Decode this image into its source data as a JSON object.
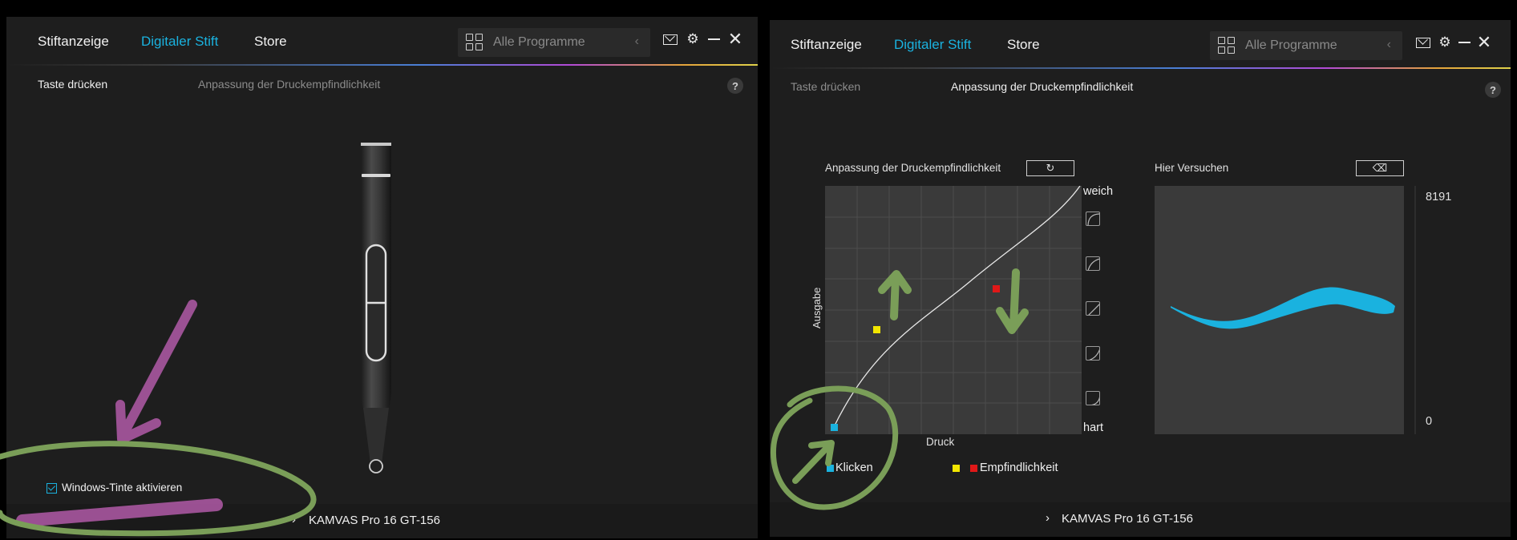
{
  "tabs": [
    {
      "label": "Stiftanzeige"
    },
    {
      "label": "Digitaler Stift"
    },
    {
      "label": "Store"
    }
  ],
  "search": {
    "placeholder": "Alle Programme"
  },
  "subtabs": {
    "press_key": "Taste drücken",
    "pressure": "Anpassung der Druckempfindlichkeit"
  },
  "help_label": "?",
  "left_panel": {
    "windows_ink": {
      "label": "Windows-Tinte aktivieren",
      "checked": true
    }
  },
  "right_panel": {
    "curve_title": "Anpassung der Druckempfindlichkeit",
    "try_title": "Hier Versuchen",
    "axis_x": "Druck",
    "axis_y": "Ausgabe",
    "soft_label": "weich",
    "hard_label": "hart",
    "pressure_max": "8191",
    "pressure_min": "0",
    "legend": {
      "click": "Klicken",
      "sensitivity": "Empfindlichkeit"
    }
  },
  "footer": {
    "device": "KAMVAS Pro 16 GT-156"
  },
  "colors": {
    "accent": "#1ab2df",
    "click_marker": "#1ab2df",
    "yellow_marker": "#f2e600",
    "red_marker": "#e01818",
    "annotation_green": "#7a9e58",
    "annotation_pink": "#b25aa8"
  }
}
